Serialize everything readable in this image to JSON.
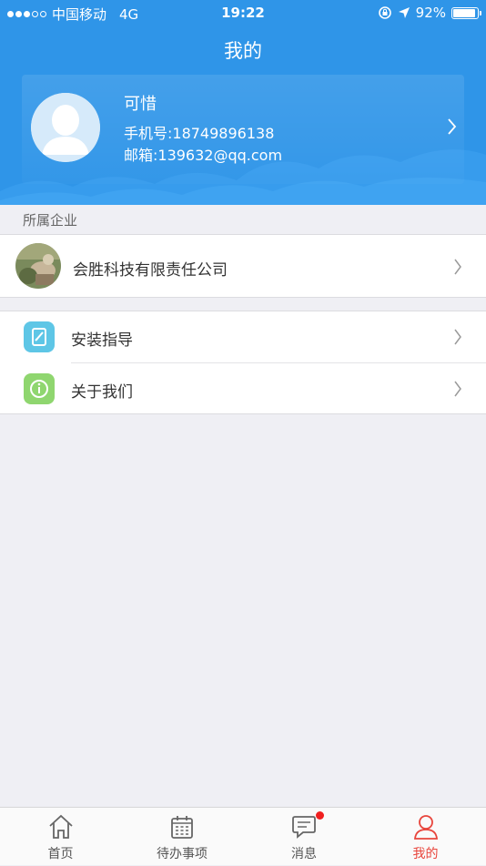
{
  "status_bar": {
    "carrier": "中国移动",
    "network": "4G",
    "time": "19:22",
    "battery": "92%",
    "battery_level": 0.92
  },
  "header": {
    "title": "我的"
  },
  "profile": {
    "name": "可惜",
    "phone": "手机号:18749896138",
    "email": "邮箱:139632@qq.com"
  },
  "company_section": {
    "title": "所属企业",
    "company_name": "会胜科技有限责任公司"
  },
  "menu": {
    "items": [
      {
        "label": "安装指导",
        "icon": "install-guide-icon",
        "color": "#5ec6e6"
      },
      {
        "label": "关于我们",
        "icon": "info-icon",
        "color": "#8fd66f"
      }
    ]
  },
  "tab_bar": {
    "tabs": [
      {
        "label": "首页",
        "icon": "home-icon"
      },
      {
        "label": "待办事项",
        "icon": "calendar-icon"
      },
      {
        "label": "消息",
        "icon": "message-icon"
      },
      {
        "label": "我的",
        "icon": "user-icon"
      }
    ],
    "active_tab": "我的",
    "active_color": "#e8453c"
  },
  "colors": {
    "header_blue": "#2f95e8",
    "background": "#efeff4",
    "badge_red": "#f01f1f"
  }
}
